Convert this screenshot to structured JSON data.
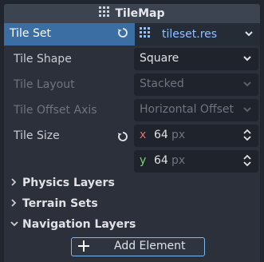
{
  "inspector": {
    "title": "TileMap",
    "tile_set": {
      "label": "Tile Set",
      "resource": "tileset.res"
    },
    "properties": [
      {
        "label": "Tile Shape",
        "value": "Square",
        "enabled": true
      },
      {
        "label": "Tile Layout",
        "value": "Stacked",
        "enabled": false
      },
      {
        "label": "Tile Offset Axis",
        "value": "Horizontal Offset",
        "enabled": false
      }
    ],
    "tile_size": {
      "label": "Tile Size",
      "x_axis": "x",
      "x_value": "64",
      "x_unit": "px",
      "y_axis": "y",
      "y_value": "64",
      "y_unit": "px"
    },
    "sections": [
      {
        "label": "Physics Layers",
        "expanded": false
      },
      {
        "label": "Terrain Sets",
        "expanded": false
      },
      {
        "label": "Navigation Layers",
        "expanded": true
      }
    ],
    "add_element_label": "Add Element"
  },
  "colors": {
    "accent": "#3b6fa3",
    "x_axis": "#e26f6f",
    "y_axis": "#7fd36a",
    "link": "#8fc2ff"
  },
  "icons": [
    "tilemap-grid-icon",
    "revert-icon",
    "tileset-resource-icon",
    "chevron-down-icon",
    "spinner-icon",
    "plus-icon"
  ]
}
